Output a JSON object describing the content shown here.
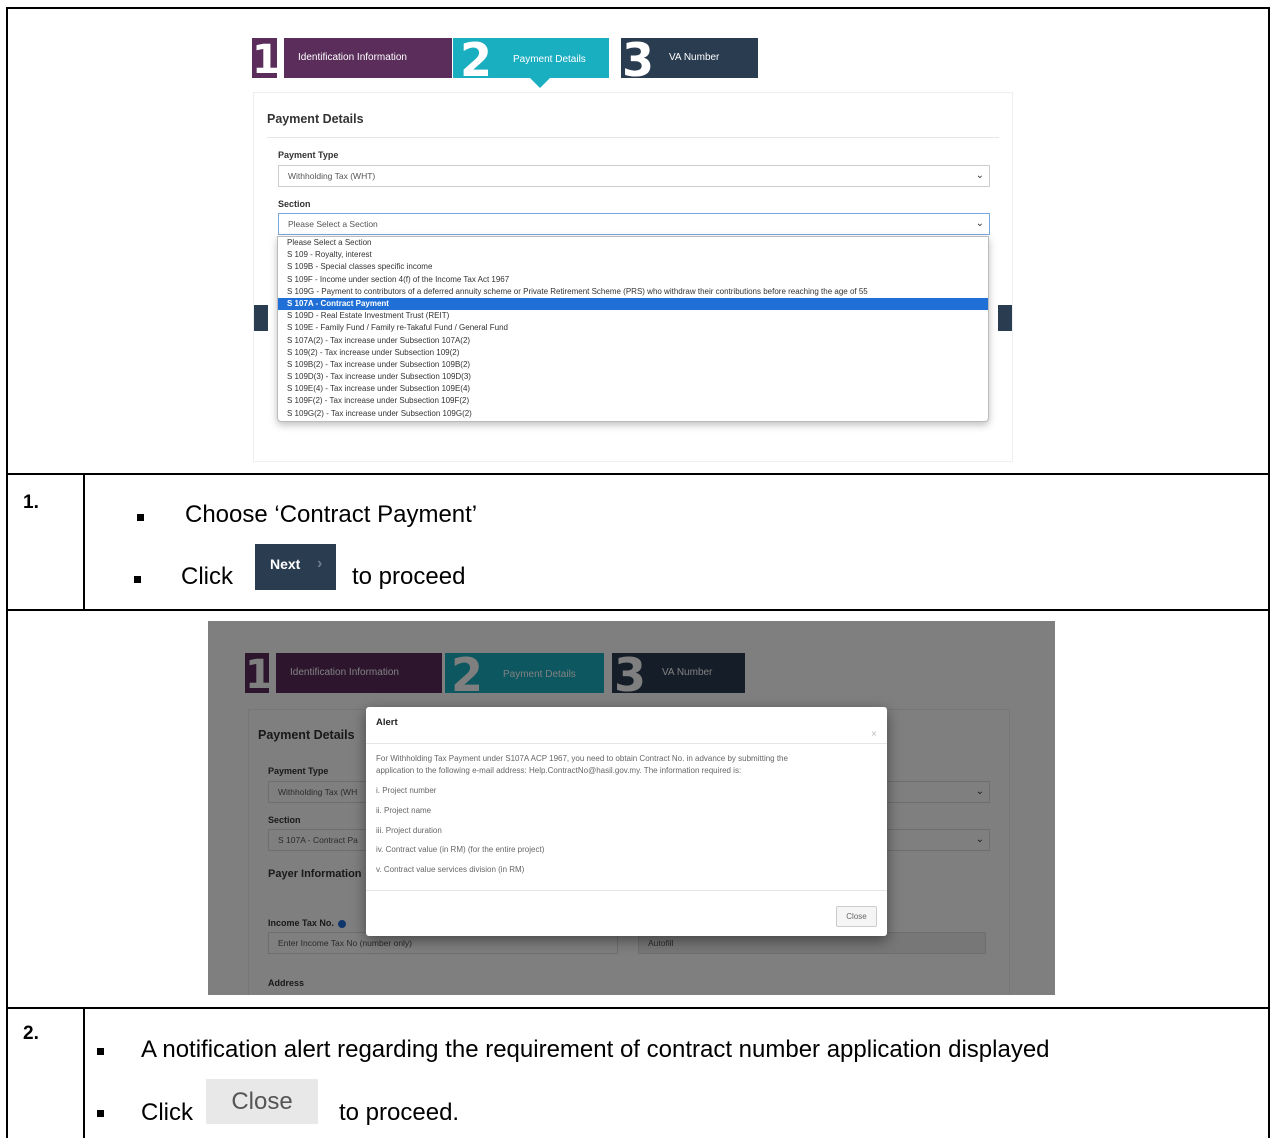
{
  "shot1": {
    "wizard": {
      "step1_number": "1",
      "step1_label": "Identification Information",
      "step2_number": "2",
      "step2_label": "Payment Details",
      "step3_number": "3",
      "step3_label": "VA Number"
    },
    "panel_title": "Payment Details",
    "payment_type_label": "Payment Type",
    "payment_type_value": "Withholding Tax (WHT)",
    "section_label": "Section",
    "section_value": "Please Select a Section",
    "section_options": [
      "Please Select a Section",
      "S 109 - Royalty, interest",
      "S 109B - Special classes specific income",
      "S 109F - Income under section 4(f) of the Income Tax Act 1967",
      "S 109G - Payment to contributors of a deferred annuity scheme or Private Retirement Scheme (PRS) who withdraw their contributions before reaching the age of 55",
      "S 107A - Contract Payment",
      "S 109D - Real Estate Investment Trust (REIT)",
      "S 109E - Family Fund / Family re-Takaful Fund / General Fund",
      "S 107A(2) - Tax increase under Subsection 107A(2)",
      "S 109(2) - Tax increase under Subsection 109(2)",
      "S 109B(2) - Tax increase under Subsection 109B(2)",
      "S 109D(3) - Tax increase under Subsection 109D(3)",
      "S 109E(4) - Tax increase under Subsection 109E(4)",
      "S 109F(2) - Tax increase under Subsection 109F(2)",
      "S 109G(2) - Tax increase under Subsection 109G(2)"
    ],
    "selected_index": 5
  },
  "step1": {
    "number": "1.",
    "line1": "Choose ‘Contract Payment’",
    "line2_prefix": "Click",
    "next_button": "Next",
    "line2_suffix": "to proceed"
  },
  "shot2": {
    "wizard": {
      "step1_number": "1",
      "step1_label": "Identification Information",
      "step2_number": "2",
      "step2_label": "Payment Details",
      "step3_number": "3",
      "step3_label": "VA Number"
    },
    "panel_title": "Payment Details",
    "payment_type_label": "Payment Type",
    "payment_type_value": "Withholding Tax (WH",
    "section_label": "Section",
    "section_value": "S 107A - Contract Pa",
    "payer_info_title": "Payer Information",
    "income_tax_label": "Income Tax No.",
    "income_tax_placeholder": "Enter Income Tax No (number only)",
    "autofill_placeholder": "Autofill",
    "address_label": "Address",
    "alert": {
      "title": "Alert",
      "close_x": "×",
      "body_line1": "For Withholding Tax Payment under S107A ACP 1967, you need to obtain Contract No. in advance by submitting the",
      "body_line2": "application to the following e-mail address: Help.ContractNo@hasil.gov.my. The information required is:",
      "items": [
        "i. Project number",
        "ii. Project name",
        "iii. Project duration",
        "iv. Contract value (in RM) (for the entire project)",
        "v. Contract value services division (in RM)"
      ],
      "close_button": "Close"
    }
  },
  "step2": {
    "number": "2.",
    "line1": "A notification alert regarding the requirement of contract number application displayed",
    "line2_prefix": "Click",
    "close_button": "Close",
    "line2_suffix": "to proceed."
  },
  "colors": {
    "step1": "#5a2d5a",
    "step2": "#1aaec1",
    "step3": "#2a3c50",
    "selected_option": "#1f6fd6",
    "next_button": "#2a3c50"
  }
}
